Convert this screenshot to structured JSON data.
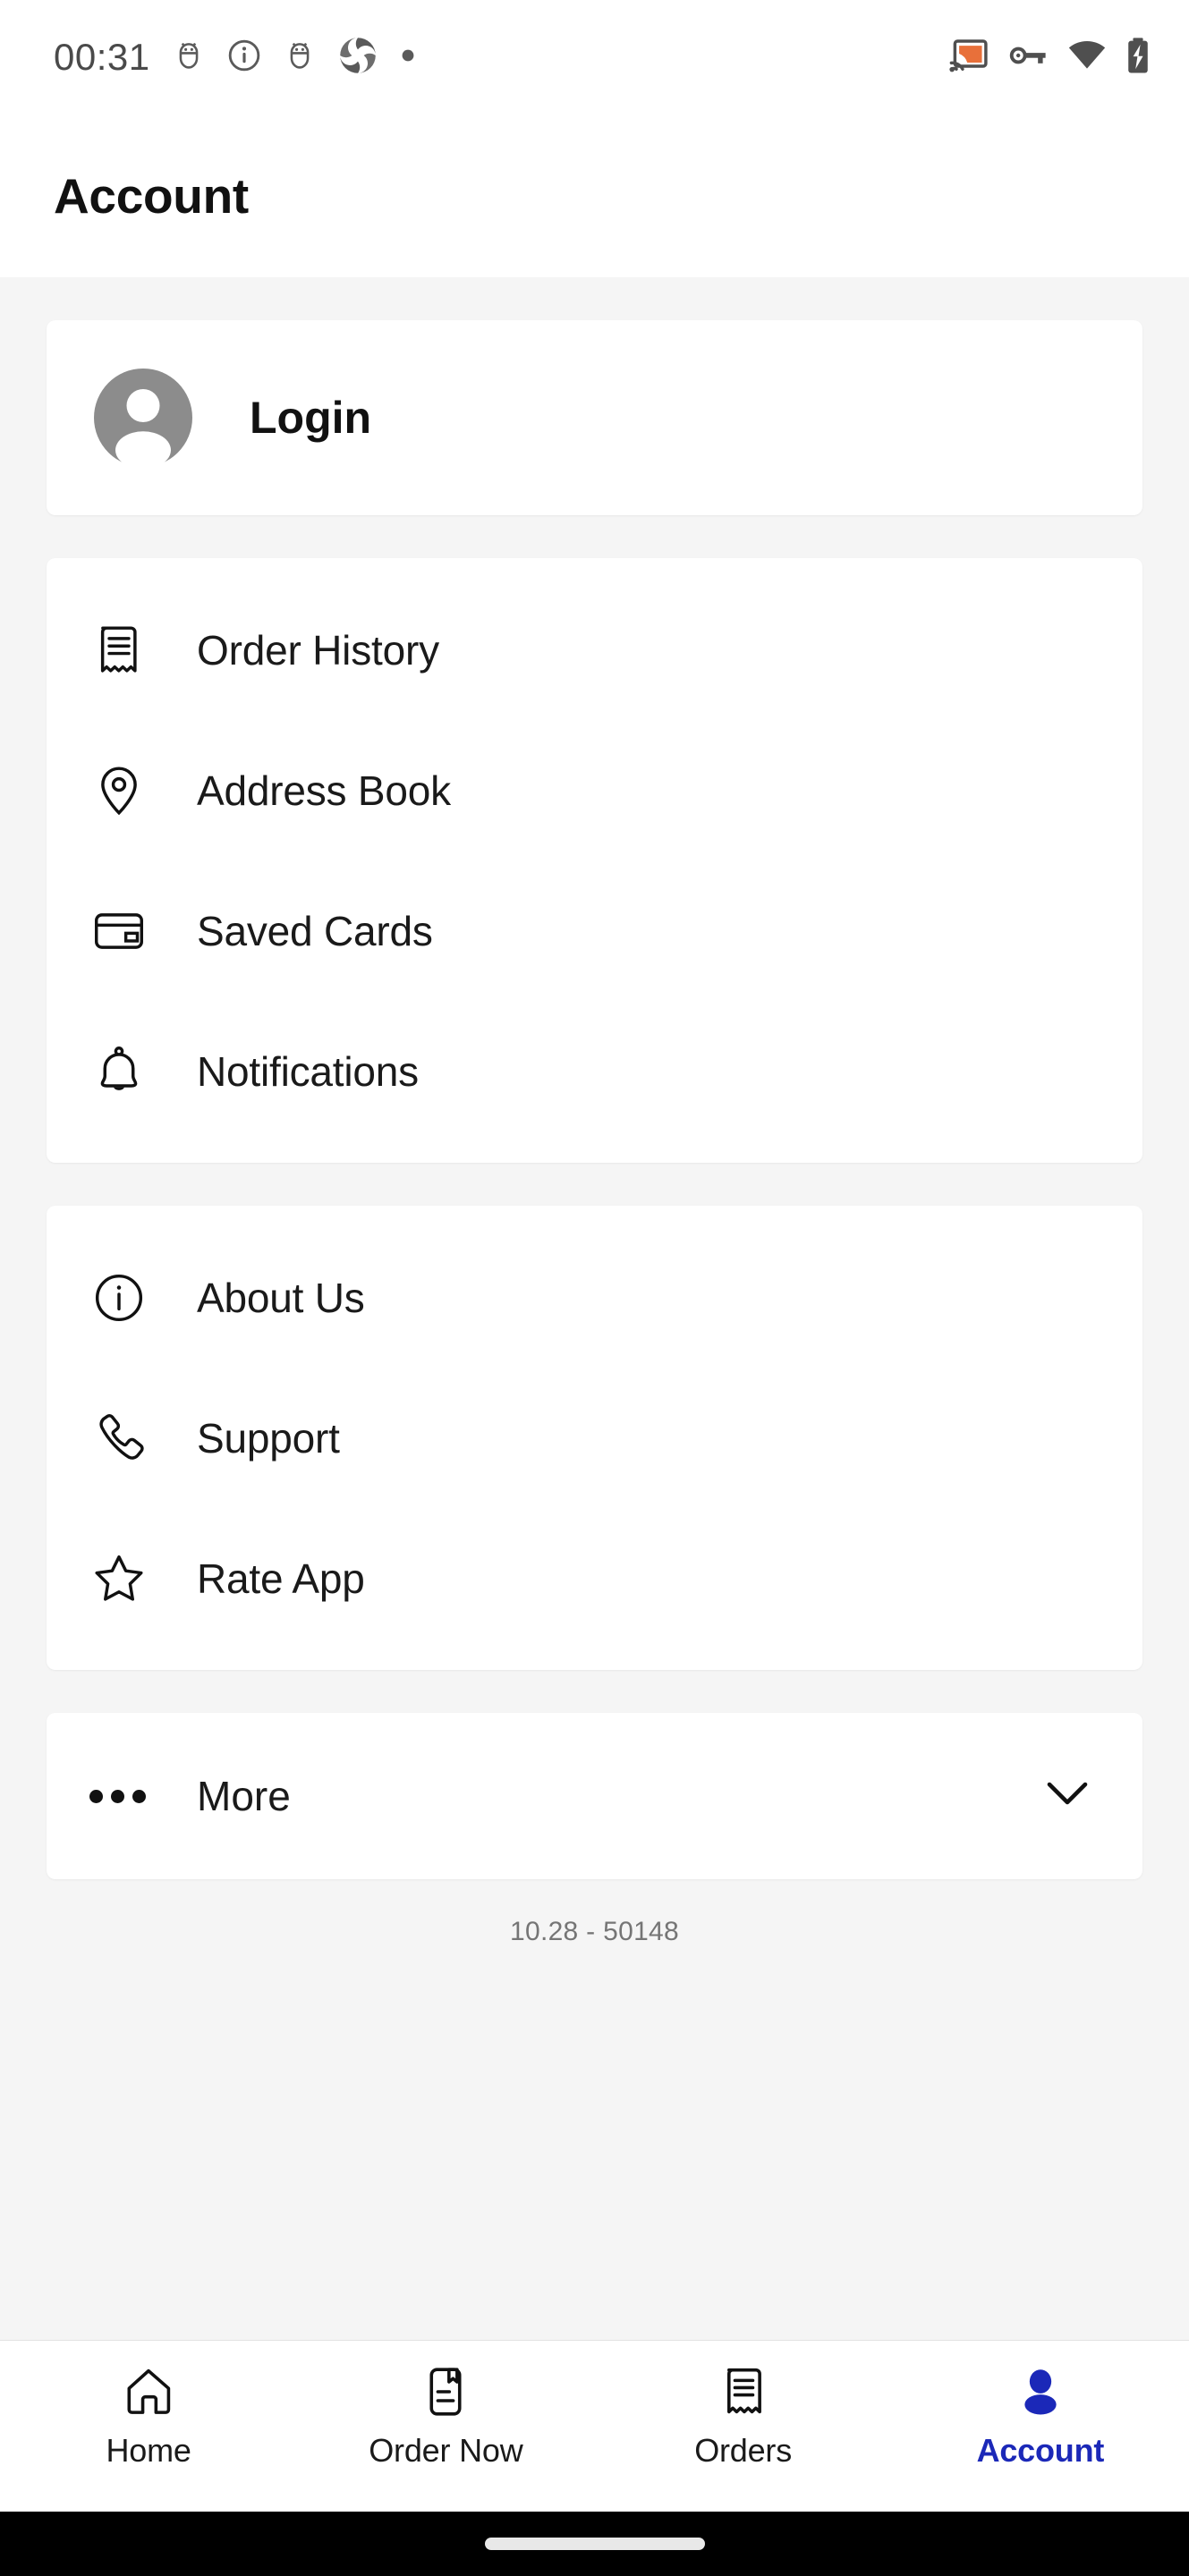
{
  "status_bar": {
    "clock": "00:31",
    "left_icons": [
      "android-bug-icon",
      "info-circle-icon",
      "android-bug-icon",
      "pinwheel-logo-icon",
      "dot-icon"
    ],
    "right_icons": [
      "cast-icon",
      "vpn-key-icon",
      "wifi-icon",
      "battery-charging-icon"
    ],
    "cast_accent": "#e8703a",
    "icon_color": "#4a4a4a"
  },
  "app_bar": {
    "title": "Account"
  },
  "login_card": {
    "label": "Login",
    "icon": "account-circle-icon",
    "avatar_color": "#8c8c8c"
  },
  "menu_group_1": {
    "items": [
      {
        "label": "Order History",
        "icon": "receipt-icon"
      },
      {
        "label": "Address Book",
        "icon": "location-pin-icon"
      },
      {
        "label": "Saved Cards",
        "icon": "credit-card-icon"
      },
      {
        "label": "Notifications",
        "icon": "bell-icon"
      }
    ]
  },
  "menu_group_2": {
    "items": [
      {
        "label": "About Us",
        "icon": "info-circle-icon"
      },
      {
        "label": "Support",
        "icon": "phone-icon"
      },
      {
        "label": "Rate App",
        "icon": "star-outline-icon"
      }
    ]
  },
  "more_row": {
    "label": "More",
    "icon": "three-dots-icon",
    "expand_icon": "chevron-down-icon"
  },
  "version_text": "10.28 - 50148",
  "bottom_nav": {
    "active_color": "#1b28b8",
    "items": [
      {
        "label": "Home",
        "icon": "home-icon",
        "active": false
      },
      {
        "label": "Order Now",
        "icon": "menu-book-icon",
        "active": false
      },
      {
        "label": "Orders",
        "icon": "receipt-icon",
        "active": false
      },
      {
        "label": "Account",
        "icon": "person-icon",
        "active": true
      }
    ]
  }
}
